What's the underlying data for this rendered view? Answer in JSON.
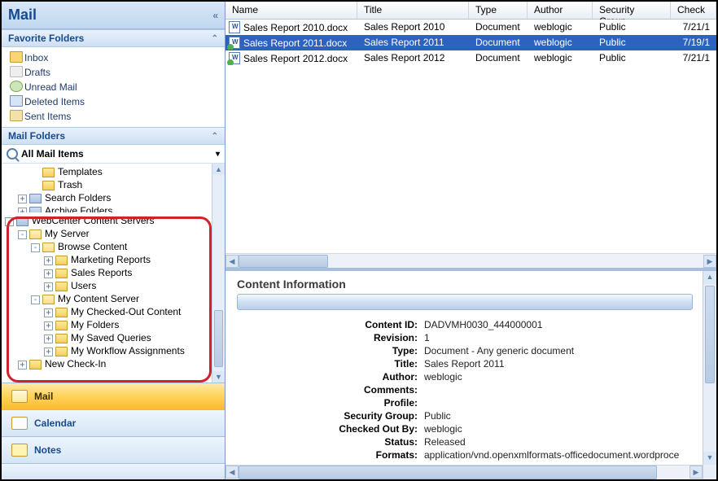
{
  "app_title": "Mail",
  "sections": {
    "favorite": "Favorite Folders",
    "mailfolders": "Mail Folders"
  },
  "favorites": [
    {
      "label": "Inbox",
      "icon": "inbox"
    },
    {
      "label": "Drafts",
      "icon": "drafts"
    },
    {
      "label": "Unread Mail",
      "icon": "unread"
    },
    {
      "label": "Deleted Items",
      "icon": "deleted"
    },
    {
      "label": "Sent Items",
      "icon": "sent"
    }
  ],
  "all_mail_label": "All Mail Items",
  "tree_top": [
    {
      "label": "Templates",
      "depth": 2,
      "exp": ""
    },
    {
      "label": "Trash",
      "depth": 2,
      "exp": ""
    },
    {
      "label": "Search Folders",
      "depth": 1,
      "exp": "+",
      "folder": "srv"
    },
    {
      "label": "Archive Folders",
      "depth": 1,
      "exp": "+",
      "folder": "srv",
      "cut": true
    }
  ],
  "wc_tree": [
    {
      "label": "WebCenter Content Servers",
      "depth": 0,
      "exp": "-",
      "folder": "srv"
    },
    {
      "label": "My Server",
      "depth": 1,
      "exp": "-",
      "folder": "open"
    },
    {
      "label": "Browse Content",
      "depth": 2,
      "exp": "-",
      "folder": "open"
    },
    {
      "label": "Marketing Reports",
      "depth": 3,
      "exp": "+"
    },
    {
      "label": "Sales Reports",
      "depth": 3,
      "exp": "+",
      "sel": true
    },
    {
      "label": "Users",
      "depth": 3,
      "exp": "+"
    },
    {
      "label": "My Content Server",
      "depth": 2,
      "exp": "-",
      "folder": "open"
    },
    {
      "label": "My Checked-Out Content",
      "depth": 3,
      "exp": "+"
    },
    {
      "label": "My Folders",
      "depth": 3,
      "exp": "+"
    },
    {
      "label": "My Saved Queries",
      "depth": 3,
      "exp": "+"
    },
    {
      "label": "My Workflow Assignments",
      "depth": 3,
      "exp": "+"
    },
    {
      "label": "New Check-In",
      "depth": 1,
      "exp": "+"
    }
  ],
  "nav_buttons": [
    {
      "label": "Mail",
      "active": true,
      "icon": "mail"
    },
    {
      "label": "Calendar",
      "active": false,
      "icon": "cal"
    },
    {
      "label": "Notes",
      "active": false,
      "icon": "notes"
    }
  ],
  "grid": {
    "columns": [
      "Name",
      "Title",
      "Type",
      "Author",
      "Security Group",
      "Check"
    ],
    "rows": [
      {
        "name": "Sales Report 2010.docx",
        "title": "Sales Report 2010",
        "type": "Document",
        "author": "weblogic",
        "secgroup": "Public",
        "checked": "7/21/1",
        "sel": false,
        "green": false
      },
      {
        "name": "Sales Report 2011.docx",
        "title": "Sales Report 2011",
        "type": "Document",
        "author": "weblogic",
        "secgroup": "Public",
        "checked": "7/19/1",
        "sel": true,
        "green": true
      },
      {
        "name": "Sales Report 2012.docx",
        "title": "Sales Report 2012",
        "type": "Document",
        "author": "weblogic",
        "secgroup": "Public",
        "checked": "7/21/1",
        "sel": false,
        "green": true
      }
    ]
  },
  "detail": {
    "heading": "Content Information",
    "fields": [
      {
        "k": "Content ID:",
        "v": "DADVMH0030_444000001"
      },
      {
        "k": "Revision:",
        "v": "1"
      },
      {
        "k": "Type:",
        "v": "Document - Any generic document"
      },
      {
        "k": "Title:",
        "v": "Sales Report 2011"
      },
      {
        "k": "Author:",
        "v": "weblogic"
      },
      {
        "k": "Comments:",
        "v": ""
      },
      {
        "k": "Profile:",
        "v": ""
      },
      {
        "k": "Security Group:",
        "v": "Public"
      },
      {
        "k": "Checked Out By:",
        "v": "weblogic"
      },
      {
        "k": "Status:",
        "v": "Released"
      },
      {
        "k": "Formats:",
        "v": "application/vnd.openxmlformats-officedocument.wordproce"
      }
    ]
  }
}
